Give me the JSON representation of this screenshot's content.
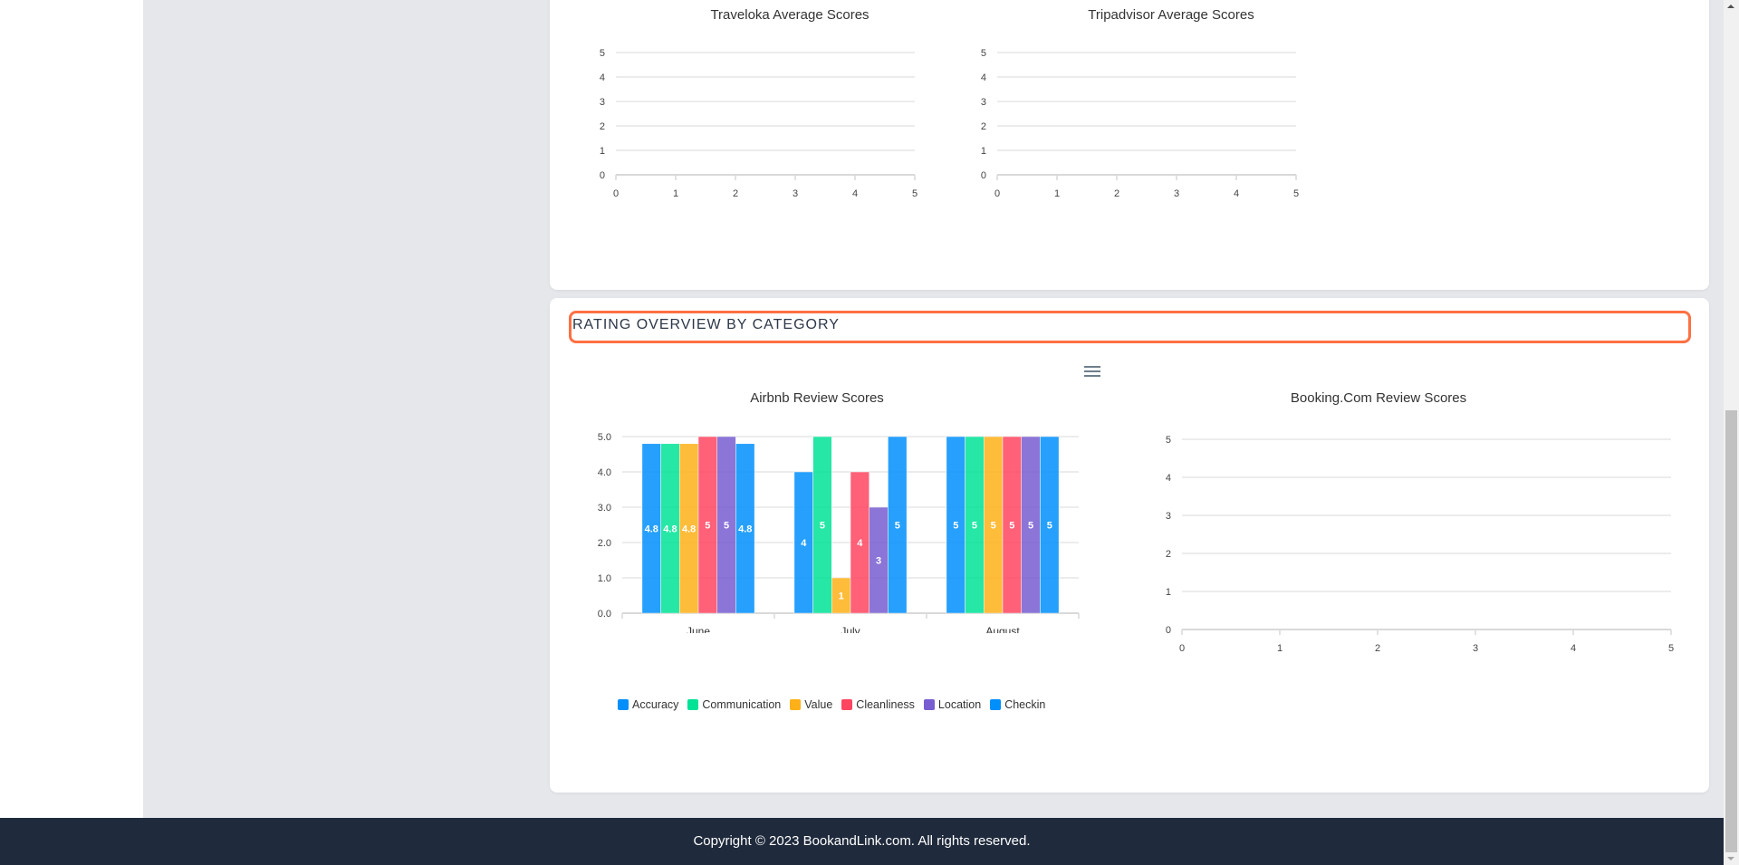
{
  "card_top": {
    "charts": [
      {
        "title": "Traveloka Average Scores"
      },
      {
        "title": "Tripadvisor Average Scores"
      }
    ]
  },
  "section": {
    "title": "RATING OVERVIEW BY CATEGORY"
  },
  "menu": {
    "icon": "hamburger-menu-icon"
  },
  "legend": [
    {
      "label": "Accuracy",
      "color": "#008ffb"
    },
    {
      "label": "Communication",
      "color": "#00e396"
    },
    {
      "label": "Value",
      "color": "#feb019"
    },
    {
      "label": "Cleanliness",
      "color": "#ff4560"
    },
    {
      "label": "Location",
      "color": "#775dd0"
    },
    {
      "label": "Checkin",
      "color": "#008ffb"
    }
  ],
  "footer": {
    "text": "Copyright © 2023 BookandLink.com. All rights reserved."
  },
  "chart_data": [
    {
      "type": "bar",
      "title": "Traveloka Average Scores",
      "categories": [],
      "series": [],
      "xticks": [
        "0",
        "1",
        "2",
        "3",
        "4",
        "5"
      ],
      "yticks": [
        "0",
        "1",
        "2",
        "3",
        "4",
        "5"
      ],
      "xlim": [
        0,
        5
      ],
      "ylim": [
        0,
        5
      ],
      "grid": true
    },
    {
      "type": "bar",
      "title": "Tripadvisor Average Scores",
      "categories": [],
      "series": [],
      "xticks": [
        "0",
        "1",
        "2",
        "3",
        "4",
        "5"
      ],
      "yticks": [
        "0",
        "1",
        "2",
        "3",
        "4",
        "5"
      ],
      "xlim": [
        0,
        5
      ],
      "ylim": [
        0,
        5
      ],
      "grid": true
    },
    {
      "type": "bar",
      "title": "Airbnb Review Scores",
      "categories": [
        "June",
        "July",
        "August"
      ],
      "series": [
        {
          "name": "Accuracy",
          "color": "#008ffb",
          "values": [
            4.8,
            4,
            5
          ]
        },
        {
          "name": "Communication",
          "color": "#00e396",
          "values": [
            4.8,
            5,
            5
          ]
        },
        {
          "name": "Value",
          "color": "#feb019",
          "values": [
            4.8,
            1,
            5
          ]
        },
        {
          "name": "Cleanliness",
          "color": "#ff4560",
          "values": [
            5,
            4,
            5
          ]
        },
        {
          "name": "Location",
          "color": "#775dd0",
          "values": [
            5,
            3,
            5
          ]
        },
        {
          "name": "Checkin",
          "color": "#008ffb",
          "values": [
            4.8,
            5,
            5
          ]
        }
      ],
      "yticks": [
        "0.0",
        "1.0",
        "2.0",
        "3.0",
        "4.0",
        "5.0"
      ],
      "ylim": [
        0,
        5
      ],
      "grid": true,
      "legend": "bottom"
    },
    {
      "type": "bar",
      "title": "Booking.Com Review Scores",
      "categories": [],
      "series": [],
      "xticks": [
        "0",
        "1",
        "2",
        "3",
        "4",
        "5"
      ],
      "yticks": [
        "0",
        "1",
        "2",
        "3",
        "4",
        "5"
      ],
      "xlim": [
        0,
        5
      ],
      "ylim": [
        0,
        5
      ],
      "grid": true
    }
  ]
}
